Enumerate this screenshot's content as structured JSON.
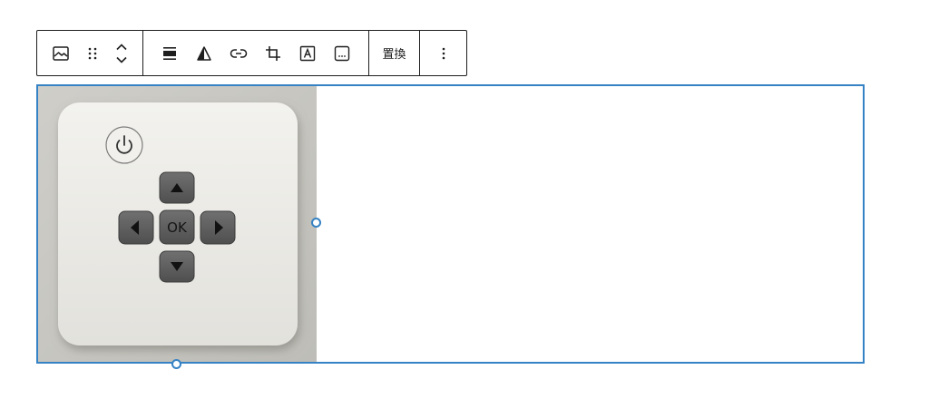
{
  "toolbar": {
    "icons": {
      "block_type": "image-icon",
      "drag": "drag-handle-icon",
      "move_up": "chevron-up-icon",
      "move_down": "chevron-down-icon",
      "align": "align-wide-icon",
      "duotone": "duotone-filter-icon",
      "link": "link-icon",
      "crop": "crop-icon",
      "text_overlay": "text-overlay-icon",
      "caption": "caption-icon",
      "more": "more-vertical-icon"
    },
    "replace_label": "置換"
  },
  "image": {
    "alt_description": "",
    "remote": {
      "ok_label": "OK"
    }
  },
  "colors": {
    "selection": "#3582c4",
    "toolbar_border": "#1e1e1e",
    "remote_body": "#e9e8e3",
    "remote_button": "#5f5f5f",
    "photo_background": "#c7c6c1"
  }
}
